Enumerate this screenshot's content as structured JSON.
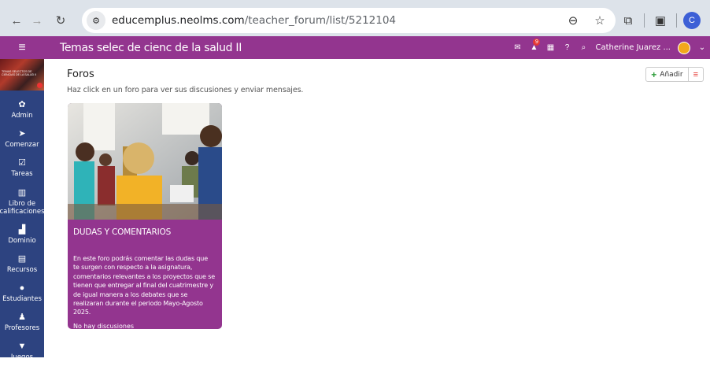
{
  "browser": {
    "url_host": "educemplus.neolms.com",
    "url_path": "/teacher_forum/list/5212104",
    "profile_initial": "C"
  },
  "appbar": {
    "course_title": "Temas selec de cienc de la salud II",
    "notification_count": "9",
    "username": "Catherine Juarez ...",
    "color": "#93358f"
  },
  "sidebar": {
    "color": "#2d4380",
    "course_thumb_text": "TEMAS SELECTOS DE CIENCIAS DE LA SALUD II",
    "items": [
      {
        "label": "Admin",
        "icon": "gear-icon"
      },
      {
        "label": "Comenzar",
        "icon": "paper-plane-icon"
      },
      {
        "label": "Tareas",
        "icon": "checkbox-icon"
      },
      {
        "label": "Libro de calificaciones",
        "icon": "gradebook-icon"
      },
      {
        "label": "Dominio",
        "icon": "bar-chart-icon"
      },
      {
        "label": "Recursos",
        "icon": "resources-icon"
      },
      {
        "label": "Estudiantes",
        "icon": "person-icon"
      },
      {
        "label": "Profesores",
        "icon": "teacher-icon"
      },
      {
        "label": "Juegos",
        "icon": "trophy-icon"
      }
    ]
  },
  "main": {
    "title": "Foros",
    "description": "Haz click en un foro para ver sus discusiones y enviar mensajes.",
    "add_label": "Añadir"
  },
  "forum_card": {
    "title": "DUDAS Y COMENTARIOS",
    "description": "En este foro podrás comentar las dudas que te surgen con respecto a la asignatura, comentarios relevantes a los proyectos que se tienen que entregar al final del cuatrimestre y de igual manera a los debates que se realizaran durante el periodo Mayo-Agosto 2025.",
    "footer": "No hay discusiones"
  }
}
